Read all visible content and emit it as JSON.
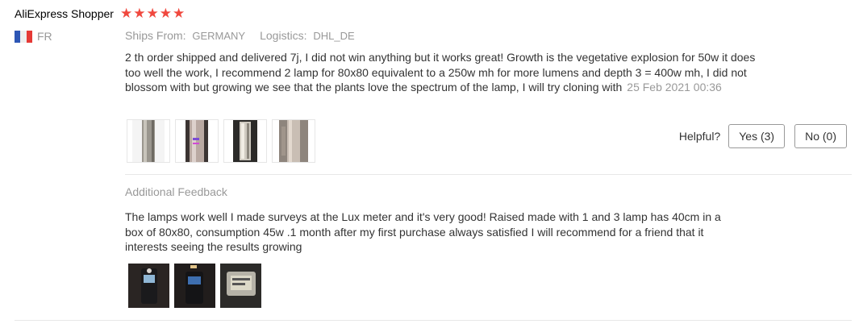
{
  "reviewer": {
    "name": "AliExpress Shopper",
    "rating": 5,
    "country_code": "FR",
    "colors": {
      "star": "#f0483e"
    }
  },
  "shipping": {
    "ships_from_label": "Ships From:",
    "ships_from_value": "GERMANY",
    "logistics_label": "Logistics:",
    "logistics_value": "DHL_DE"
  },
  "review": {
    "text": "2 th order shipped and delivered 7j, I did not win anything but it works great! Growth is the vegetative explosion for 50w it does too well the work, I recommend 2 lamp for 80x80 equivalent to a 250w mh for more lumens and depth 3 = 400w mh, I did not blossom with but growing we see that the plants love the spectrum of the lamp, I will try cloning with",
    "date": "25 Feb 2021 00:36",
    "photos": [
      "lamp-photo-1",
      "lamp-photo-2",
      "lamp-photo-3",
      "lamp-photo-4"
    ]
  },
  "helpful": {
    "label": "Helpful?",
    "yes_label": "Yes (3)",
    "no_label": "No (0)"
  },
  "additional": {
    "title": "Additional Feedback",
    "text": "The lamps work well I made surveys at the Lux meter and it's very good! Raised made with 1 and 3 lamp has 40cm in a box of 80x80, consumption 45w .1 month after my first purchase always satisfied I will recommend for a friend that it interests seeing the results growing",
    "photos": [
      "lux-meter-photo-1",
      "lux-meter-photo-2",
      "lux-meter-photo-3"
    ]
  }
}
